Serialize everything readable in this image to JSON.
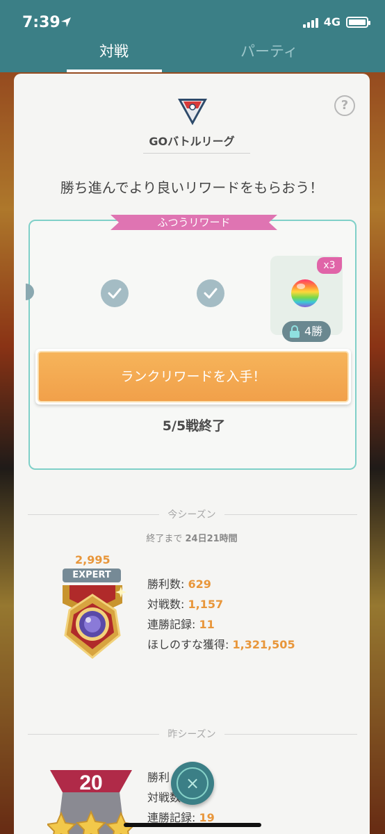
{
  "status_bar": {
    "time": "7:39",
    "network": "4G"
  },
  "tabs": [
    {
      "label": "対戦",
      "active": true
    },
    {
      "label": "パーティ",
      "active": false
    }
  ],
  "league": {
    "name": "GOバトルリーグ",
    "help_label": "?"
  },
  "promo_text": "勝ち進んでより良いリワードをもらおう！",
  "rewards": {
    "ribbon_label": "ふつうリワード",
    "reward_multiplier": "x3",
    "lock_label": "4勝",
    "get_button_label": "ランクリワードを入手！",
    "battles_status": "5/5戦終了"
  },
  "current_season": {
    "label": "今シーズン",
    "ends_prefix": "終了まで",
    "ends_value": "24日21時間",
    "rating": "2,995",
    "rank": "EXPERT",
    "stats": [
      {
        "label": "勝利数: ",
        "value": "629"
      },
      {
        "label": "対戦数: ",
        "value": "1,157"
      },
      {
        "label": "連勝記録: ",
        "value": "11"
      },
      {
        "label": "ほしのすな獲得: ",
        "value": "1,321,505"
      }
    ]
  },
  "previous_season": {
    "label": "昨シーズン",
    "rank_number": "20",
    "stats": [
      {
        "label": "勝利",
        "value": ""
      },
      {
        "label": "対戦数",
        "value": ""
      },
      {
        "label": "連勝記録: ",
        "value": "19"
      }
    ]
  },
  "colors": {
    "header": "#3b7f86",
    "accent_orange": "#e8963a",
    "ribbon_pink": "#df74b2",
    "reward_border": "#7fd0c8"
  }
}
